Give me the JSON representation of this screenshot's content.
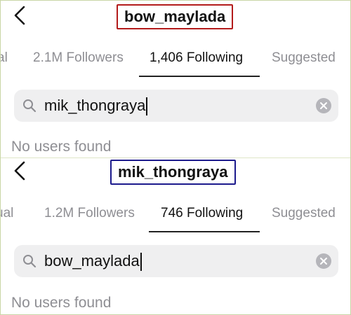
{
  "colors": {
    "panel1_title_border": "#b31b1b",
    "panel2_title_border": "#1c1a8c",
    "tab_inactive": "#8e8e93",
    "search_bg": "#efeff0"
  },
  "panels": [
    {
      "username": "bow_maylada",
      "tabs": [
        "al",
        "2.1M Followers",
        "1,406 Following",
        "Suggested"
      ],
      "search_value": "mik_thongraya",
      "empty_message": "No users found"
    },
    {
      "username": "mik_thongraya",
      "tabs": [
        "ual",
        "1.2M Followers",
        "746 Following",
        "Suggested"
      ],
      "search_value": "bow_maylada",
      "empty_message": "No users found"
    }
  ]
}
